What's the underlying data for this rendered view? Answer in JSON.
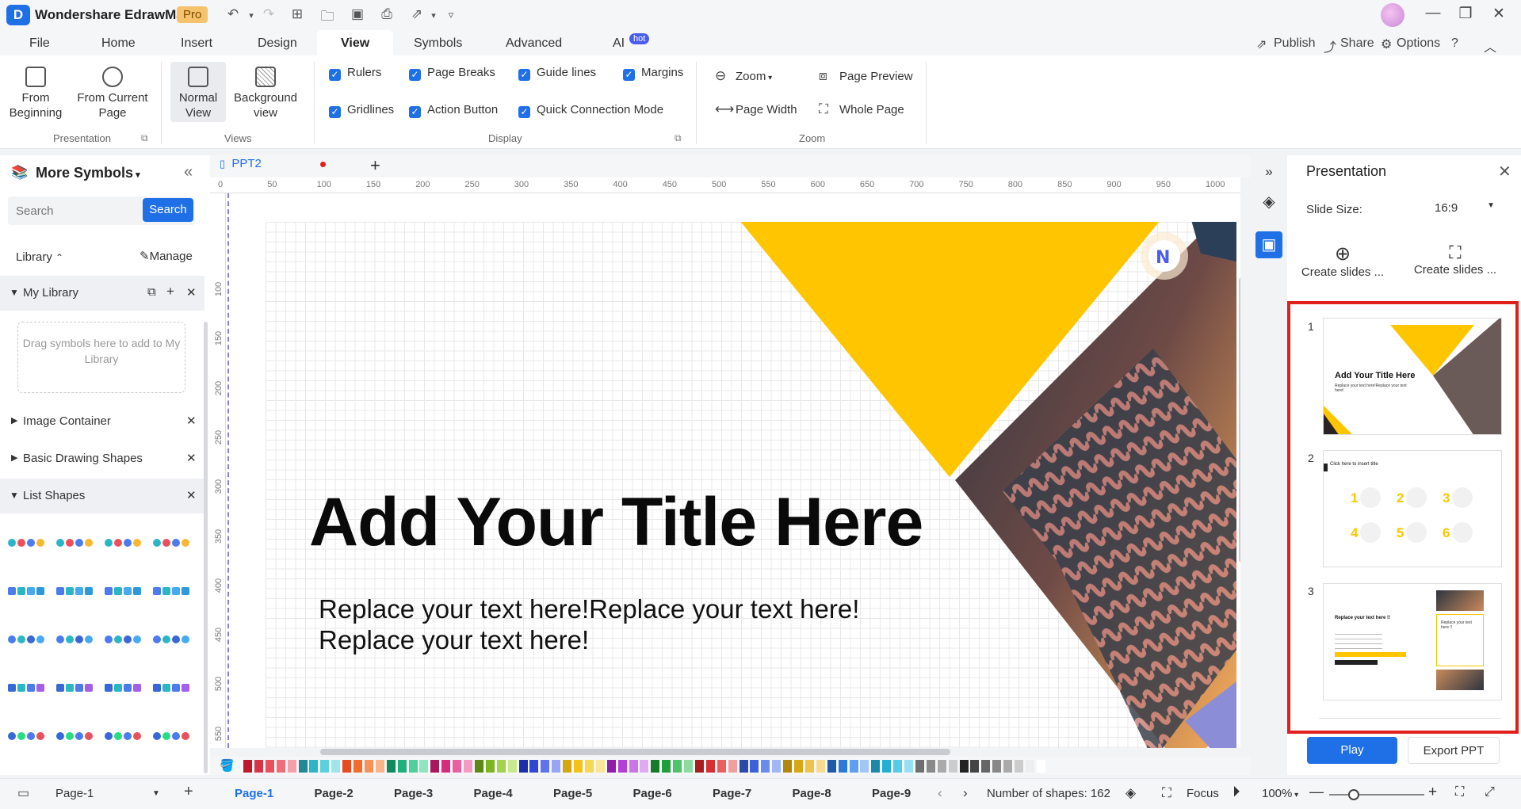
{
  "app": {
    "name": "Wondershare EdrawMax",
    "badge": "Pro"
  },
  "menu": {
    "items": [
      "File",
      "Home",
      "Insert",
      "Design",
      "View",
      "Symbols",
      "Advanced",
      "AI"
    ],
    "active": "View",
    "ai_badge": "hot",
    "publish": "Publish",
    "share": "Share",
    "options": "Options"
  },
  "ribbon": {
    "presentation": {
      "from_beginning_1": "From",
      "from_beginning_2": "Beginning",
      "from_current_1": "From Current",
      "from_current_2": "Page",
      "group": "Presentation"
    },
    "views": {
      "normal_1": "Normal",
      "normal_2": "View",
      "background_1": "Background",
      "background_2": "view",
      "group": "Views"
    },
    "display": {
      "rulers": "Rulers",
      "page_breaks": "Page Breaks",
      "guide_lines": "Guide lines",
      "margins": "Margins",
      "gridlines": "Gridlines",
      "action_button": "Action Button",
      "quick_connection": "Quick Connection Mode",
      "group": "Display"
    },
    "zoom": {
      "zoom": "Zoom",
      "page_preview": "Page Preview",
      "page_width": "Page Width",
      "whole_page": "Whole Page",
      "group": "Zoom"
    }
  },
  "left_panel": {
    "title": "More Symbols",
    "search_placeholder": "Search",
    "search_button": "Search",
    "library": "Library",
    "manage": "Manage",
    "my_library": "My Library",
    "dropzone": "Drag symbols here to add to My Library",
    "sections": [
      "Image Container",
      "Basic Drawing Shapes",
      "List Shapes"
    ]
  },
  "document": {
    "tab": "PPT2",
    "ruler_h": [
      "0",
      "50",
      "100",
      "150",
      "200",
      "250",
      "300",
      "350",
      "400",
      "450",
      "500",
      "550",
      "600",
      "650",
      "700",
      "750",
      "800",
      "850",
      "900",
      "950",
      "1000"
    ],
    "ruler_v": [
      "100",
      "150",
      "200",
      "250",
      "300",
      "350",
      "400",
      "450",
      "500",
      "550"
    ],
    "slide_title": "Add Your Title Here",
    "slide_sub_1": "Replace your text here!Replace your text here!",
    "slide_sub_2": "Replace your text here!"
  },
  "presentation_panel": {
    "title": "Presentation",
    "slide_size_label": "Slide Size:",
    "slide_size_value": "16:9",
    "create_slides_1": "Create slides ...",
    "create_slides_2": "Create slides ...",
    "thumbs": [
      {
        "num": "1",
        "title": "Add Your Title Here",
        "sub": "Replace your text here!Replace your text here!"
      },
      {
        "num": "2",
        "title": "Click here to insert title",
        "nums": [
          "1",
          "2",
          "3",
          "4",
          "5",
          "6"
        ]
      },
      {
        "num": "3",
        "title": "Replace your text here !!",
        "side": "Replace your text here !!"
      }
    ],
    "play": "Play",
    "export": "Export PPT"
  },
  "status": {
    "page_select": "Page-1",
    "pages": [
      "Page-1",
      "Page-2",
      "Page-3",
      "Page-4",
      "Page-5",
      "Page-6",
      "Page-7",
      "Page-8",
      "Page-9"
    ],
    "active_page": "Page-1",
    "shape_count": "Number of shapes: 162",
    "focus": "Focus",
    "zoom": "100%"
  },
  "colors": {
    "accent": "#1f6fe6",
    "slide_yellow": "#ffc600",
    "highlight_red": "#e0201b"
  }
}
